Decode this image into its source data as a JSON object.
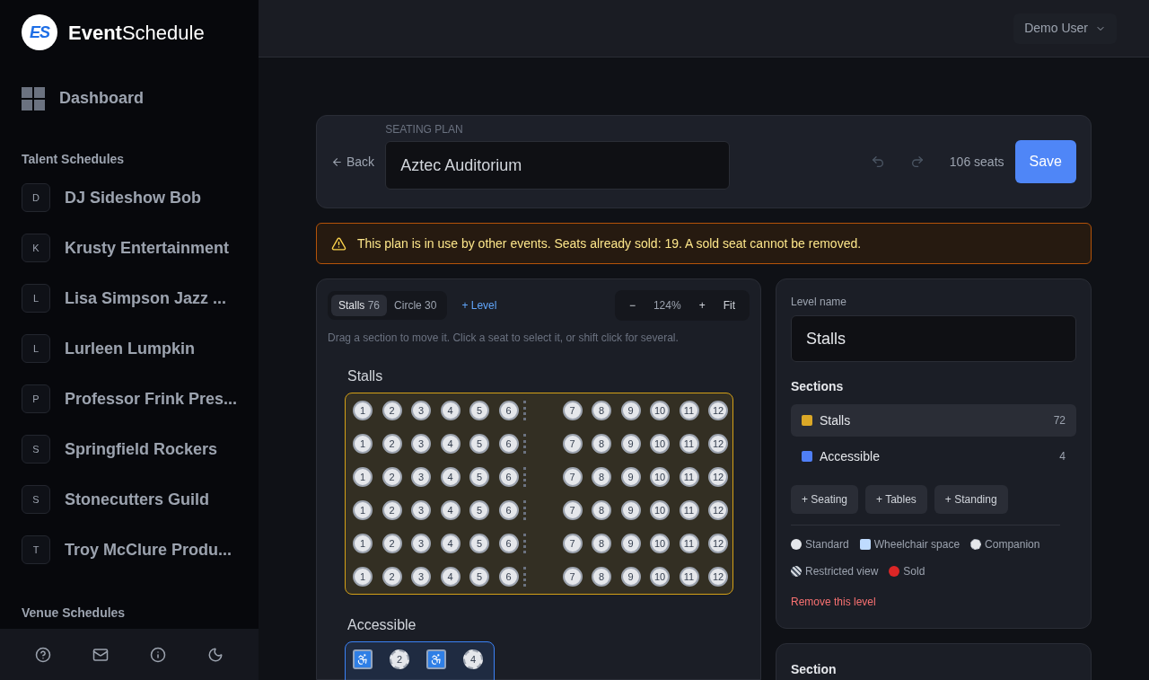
{
  "brand": {
    "mark": "ES",
    "name": "**Event**Schedule"
  },
  "sidebar": {
    "dashboard": "Dashboard",
    "groups": [
      {
        "title": "Talent Schedules",
        "items": [
          {
            "initial": "D",
            "label": "DJ Sideshow Bob"
          },
          {
            "initial": "K",
            "label": "Krusty Entertainment"
          },
          {
            "initial": "L",
            "label": "Lisa Simpson Jazz ..."
          },
          {
            "initial": "L",
            "label": "Lurleen Lumpkin"
          },
          {
            "initial": "P",
            "label": "Professor Frink Pres..."
          },
          {
            "initial": "S",
            "label": "Springfield Rockers"
          },
          {
            "initial": "S",
            "label": "Stonecutters Guild"
          },
          {
            "initial": "T",
            "label": "Troy McClure Produ..."
          }
        ]
      },
      {
        "title": "Venue Schedules"
      }
    ]
  },
  "user": {
    "name": "Demo User"
  },
  "editor": {
    "back": "Back",
    "plan_label": "SEATING PLAN",
    "plan_name": "Aztec Auditorium",
    "seat_count": "106 seats",
    "save": "Save"
  },
  "alert": "This plan is in use by other events. Seats already sold: 19. A sold seat cannot be removed.",
  "levels": [
    {
      "name": "Stalls",
      "count": "76",
      "selected": true
    },
    {
      "name": "Circle",
      "count": "30",
      "selected": false
    }
  ],
  "add_level": "+ Level",
  "zoom": {
    "minus": "−",
    "value": "124%",
    "plus": "+",
    "fit": "Fit"
  },
  "hint": "Drag a section to move it. Click a seat to select it, or shift click for several.",
  "canvas_sections": [
    {
      "name": "Stalls",
      "color": "#d4a017",
      "rows": [
        [
          "1",
          "2",
          "3",
          "4",
          "5",
          "6",
          "7",
          "8",
          "9",
          "10",
          "11",
          "12"
        ],
        [
          "1",
          "2",
          "3",
          "4",
          "5",
          "6",
          "7",
          "8",
          "9",
          "10",
          "11",
          "12"
        ],
        [
          "1",
          "2",
          "3",
          "4",
          "5",
          "6",
          "7",
          "8",
          "9",
          "10",
          "11",
          "12"
        ],
        [
          "1",
          "2",
          "3",
          "4",
          "5",
          "6",
          "7",
          "8",
          "9",
          "10",
          "11",
          "12"
        ],
        [
          "1",
          "2",
          "3",
          "4",
          "5",
          "6",
          "7",
          "8",
          "9",
          "10",
          "11",
          "12"
        ],
        [
          "1",
          "2",
          "3",
          "4",
          "5",
          "6",
          "7",
          "8",
          "9",
          "10",
          "11",
          "12"
        ]
      ]
    },
    {
      "name": "Accessible",
      "color": "#3b82f6",
      "seats": [
        {
          "kind": "wheelchair"
        },
        {
          "kind": "companion",
          "label": "2"
        },
        {
          "kind": "wheelchair"
        },
        {
          "kind": "companion",
          "label": "4"
        }
      ]
    }
  ],
  "level_panel": {
    "label": "Level name",
    "value": "Stalls",
    "sections_title": "Sections",
    "sections": [
      {
        "name": "Stalls",
        "count": "72",
        "color": "#dba827",
        "selected": true
      },
      {
        "name": "Accessible",
        "count": "4",
        "color": "#4f7ff7",
        "selected": false
      }
    ],
    "add_buttons": [
      "+ Seating",
      "+ Tables",
      "+ Standing"
    ],
    "legend": [
      {
        "kind": "standard",
        "label": "Standard"
      },
      {
        "kind": "wheelchair",
        "label": "Wheelchair space"
      },
      {
        "kind": "companion",
        "label": "Companion"
      },
      {
        "kind": "restricted",
        "label": "Restricted view"
      },
      {
        "kind": "sold",
        "label": "Sold"
      }
    ],
    "remove": "Remove this level"
  },
  "section_panel": {
    "title": "Section"
  }
}
